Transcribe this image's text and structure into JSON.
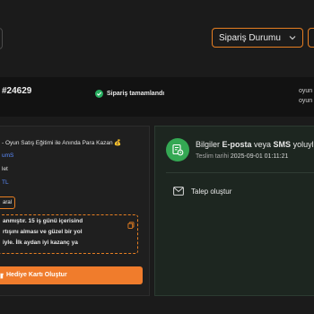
{
  "topbar": {
    "status_select": {
      "label": "Sipariş Durumu"
    }
  },
  "order": {
    "id": "#24629",
    "status_text": "Sipariş tamamlandı",
    "right_text_1": "oyun",
    "right_text_2": "oyun"
  },
  "left_panel": {
    "course_title": "- Oyun Satış Eğitimi ile Anında Para Kazan 💰",
    "line_1": "umS",
    "line_2": "let",
    "line_3": "TL",
    "mini_button": "aral",
    "note_lines": [
      "anmıştır. 15 iş günü içerisind",
      "rtışını alması ve güzel bir yol",
      "iyle. İlk aydan iyi kazanç ya"
    ],
    "gift_button": "Hediye Kartı Oluştur"
  },
  "right_panel": {
    "info_prefix": "Bilgiler ",
    "info_eposta": "E-posta",
    "info_mid": " veya ",
    "info_sms": "SMS",
    "info_suffix": " yoluyla i",
    "delivery_label": "Teslim tarihi ",
    "delivery_date": "2025-09-01 01:11:21",
    "ticket_label": "Talep oluştur"
  },
  "colors": {
    "accent": "#e67e22",
    "success": "#27ae60",
    "link": "#5b8cff"
  }
}
